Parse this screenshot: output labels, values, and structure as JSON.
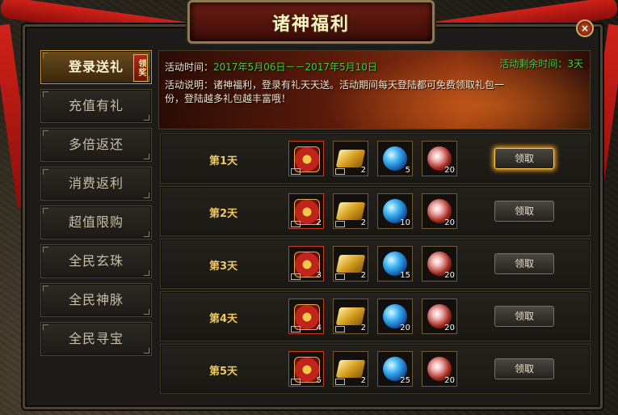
{
  "window": {
    "title": "诸神福利",
    "close_label": "×"
  },
  "sidebar": {
    "items": [
      {
        "label": "登录送礼",
        "active": true,
        "tag": "领奖"
      },
      {
        "label": "充值有礼"
      },
      {
        "label": "多倍返还"
      },
      {
        "label": "消费返利"
      },
      {
        "label": "超值限购"
      },
      {
        "label": "全民玄珠"
      },
      {
        "label": "全民神脉"
      },
      {
        "label": "全民寻宝"
      }
    ]
  },
  "banner": {
    "time_label": "活动时间：",
    "time_value": "2017年5月06日－－2017年5月10日",
    "remaining_label": "活动剩余时间：",
    "remaining_value": "3天",
    "desc_label": "活动说明：",
    "desc_text": "诸神福利，登录有礼天天送。活动期间每天登陆都可免费领取礼包一份，登陆越多礼包越丰富哦！"
  },
  "rows": [
    {
      "day": "第1天",
      "items": [
        "",
        "2",
        "5",
        "20"
      ],
      "claim_label": "领取",
      "highlight": true
    },
    {
      "day": "第2天",
      "items": [
        "2",
        "2",
        "10",
        "20"
      ],
      "claim_label": "领取"
    },
    {
      "day": "第3天",
      "items": [
        "3",
        "2",
        "15",
        "20"
      ],
      "claim_label": "领取"
    },
    {
      "day": "第4天",
      "items": [
        "4",
        "2",
        "20",
        "20"
      ],
      "claim_label": "领取"
    },
    {
      "day": "第5天",
      "items": [
        "5",
        "2",
        "25",
        "20"
      ],
      "claim_label": "领取"
    }
  ],
  "item_icons": [
    "red-seal-icon",
    "gold-bars-icon",
    "blue-orb-icon",
    "fire-orb-icon"
  ],
  "colors": {
    "accent_gold": "#f0c85a",
    "green_text": "#3ad23a",
    "ribbon_red": "#d0221a"
  }
}
